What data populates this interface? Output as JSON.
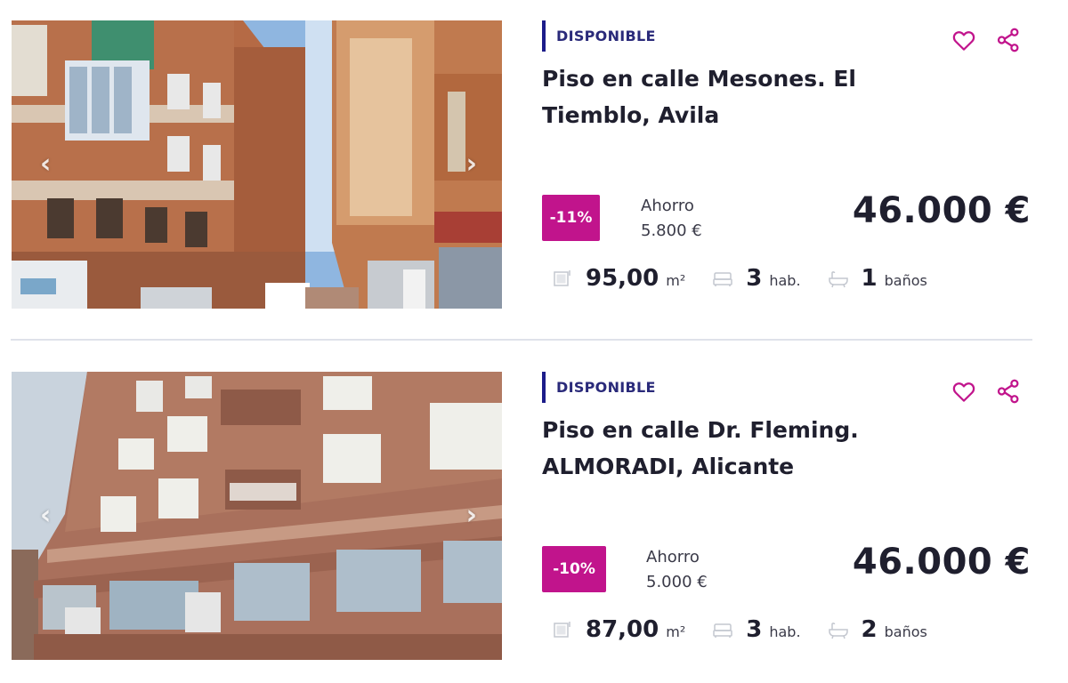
{
  "listings": [
    {
      "status": "DISPONIBLE",
      "title": "Piso en calle Mesones. El Tiemblo, Avila",
      "discount": "-11%",
      "savings_label": "Ahorro",
      "savings_amount": "5.800 €",
      "price": "46.000 €",
      "features": {
        "area_value": "95,00",
        "area_unit": "m²",
        "rooms_value": "3",
        "rooms_unit": "hab.",
        "baths_value": "1",
        "baths_unit": "baños"
      },
      "icons": [
        "favorite-heart-icon",
        "share-icon",
        "chevron-left-icon",
        "chevron-right-icon",
        "area-icon",
        "bed-icon",
        "bathtub-icon"
      ]
    },
    {
      "status": "DISPONIBLE",
      "title": "Piso en calle Dr. Fleming. ALMORADI, Alicante",
      "discount": "-10%",
      "savings_label": "Ahorro",
      "savings_amount": "5.000 €",
      "price": "46.000 €",
      "features": {
        "area_value": "87,00",
        "area_unit": "m²",
        "rooms_value": "3",
        "rooms_unit": "hab.",
        "baths_value": "2",
        "baths_unit": "baños"
      },
      "icons": [
        "favorite-heart-icon",
        "share-icon",
        "chevron-left-icon",
        "chevron-right-icon",
        "area-icon",
        "bed-icon",
        "bathtub-icon"
      ]
    }
  ],
  "colors": {
    "accent": "#c1148c",
    "status_bar": "#1c1c8a",
    "divider": "#dfe2ea"
  }
}
